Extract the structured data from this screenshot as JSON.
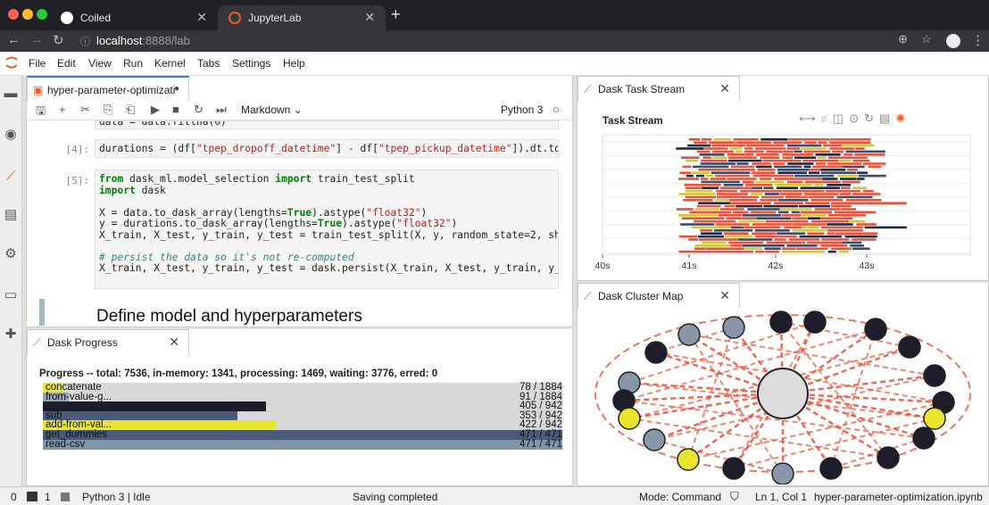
{
  "browser": {
    "tabs": [
      {
        "title": "Coiled",
        "active": false
      },
      {
        "title": "JupyterLab",
        "active": true
      }
    ],
    "url_host": "localhost",
    "url_rest": ":8888/lab"
  },
  "menu": [
    "File",
    "Edit",
    "View",
    "Run",
    "Kernel",
    "Tabs",
    "Settings",
    "Help"
  ],
  "notebook": {
    "tab_title": "hyper-parameter-optimizati",
    "cell_type": "Markdown",
    "kernel": "Python 3",
    "cells": {
      "c0_line": "data = data.fillna(0)",
      "c4_prompt": "[4]:",
      "c5_prompt": "[5]:",
      "heading": "Define model and hyperparameters"
    }
  },
  "progress": {
    "tab_title": "Dask Progress",
    "summary": "Progress -- total: 7536, in-memory: 1341, processing: 1469, waiting: 3776, erred: 0",
    "rows": [
      {
        "label": "concatenate",
        "count": "78 / 1884",
        "fraction": 0.04,
        "color": "#e8e52c"
      },
      {
        "label": "from-value-g...",
        "count": "91 / 1884",
        "fraction": 0.05,
        "color": "#9aa3b0"
      },
      {
        "label": "",
        "count": "405 / 942",
        "fraction": 0.43,
        "color": "#1d1d2b"
      },
      {
        "label": "sub",
        "count": "353 / 942",
        "fraction": 0.375,
        "color": "#4b5a78"
      },
      {
        "label": "add-from-val...",
        "count": "422 / 942",
        "fraction": 0.448,
        "color": "#e8e52c"
      },
      {
        "label": "get_dummies",
        "count": "471 / 471",
        "fraction": 1.0,
        "color": "#4b5a78"
      },
      {
        "label": "read-csv",
        "count": "471 / 471",
        "fraction": 1.0,
        "color": "#7e95ab"
      }
    ]
  },
  "task_stream": {
    "tab_title": "Dask Task Stream",
    "title": "Task Stream",
    "ticks": [
      "40s",
      "41s",
      "42s",
      "43s"
    ]
  },
  "cluster_map": {
    "tab_title": "Dask Cluster Map"
  },
  "status": {
    "left_count": "0",
    "terminals": "1",
    "kernel_state": "Python 3 | Idle",
    "message": "Saving completed",
    "mode": "Mode: Command",
    "position": "Ln 1, Col 1",
    "filename": "hyper-parameter-optimization.ipynb"
  },
  "colors": {
    "accent": "#2c7fd1",
    "dask_orange": "#e85d2a",
    "yellow": "#e8e52c",
    "navy": "#1d1d2b"
  }
}
